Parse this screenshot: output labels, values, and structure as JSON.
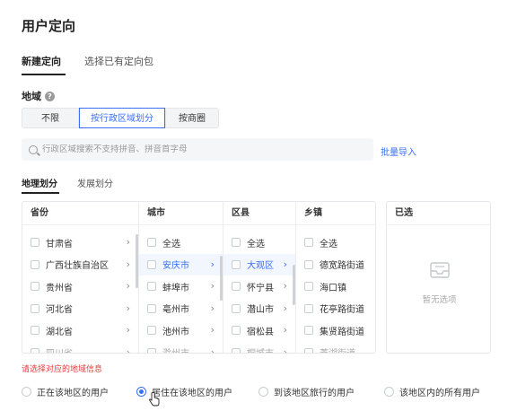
{
  "page_title": "用户定向",
  "mode_tabs": [
    {
      "label": "新建定向",
      "active": true
    },
    {
      "label": "选择已有定向包",
      "active": false
    }
  ],
  "region_section": {
    "label": "地域",
    "help_icon": "question-circle-icon"
  },
  "region_modes": [
    {
      "label": "不限",
      "active": false
    },
    {
      "label": "按行政区域划分",
      "active": true
    },
    {
      "label": "按商圈",
      "active": false
    }
  ],
  "search": {
    "placeholder": "行政区域搜索不支持拼音、拼音首字母",
    "value": "",
    "icon": "search-icon"
  },
  "bulk_import_label": "批量导入",
  "division_tabs": [
    {
      "label": "地理划分",
      "active": true
    },
    {
      "label": "发展划分",
      "active": false
    }
  ],
  "picker": {
    "columns": [
      {
        "header": "省份",
        "items": [
          {
            "label": "甘肃省",
            "has_children": true,
            "selected": false
          },
          {
            "label": "广西壮族自治区",
            "has_children": true,
            "selected": false
          },
          {
            "label": "贵州省",
            "has_children": true,
            "selected": false
          },
          {
            "label": "河北省",
            "has_children": true,
            "selected": false
          },
          {
            "label": "湖北省",
            "has_children": true,
            "selected": false
          },
          {
            "label": "四川省",
            "has_children": true,
            "selected": false,
            "partial": true
          }
        ]
      },
      {
        "header": "城市",
        "items": [
          {
            "label": "全选",
            "has_children": false,
            "selected": false
          },
          {
            "label": "安庆市",
            "has_children": true,
            "selected": true
          },
          {
            "label": "蚌埠市",
            "has_children": true,
            "selected": false
          },
          {
            "label": "亳州市",
            "has_children": true,
            "selected": false
          },
          {
            "label": "池州市",
            "has_children": true,
            "selected": false
          },
          {
            "label": "滁州市",
            "has_children": true,
            "selected": false,
            "partial": true
          }
        ]
      },
      {
        "header": "区县",
        "items": [
          {
            "label": "全选",
            "has_children": false,
            "selected": false
          },
          {
            "label": "大观区",
            "has_children": true,
            "selected": true
          },
          {
            "label": "怀宁县",
            "has_children": true,
            "selected": false
          },
          {
            "label": "潜山市",
            "has_children": true,
            "selected": false
          },
          {
            "label": "宿松县",
            "has_children": true,
            "selected": false
          },
          {
            "label": "桐城市",
            "has_children": true,
            "selected": false,
            "partial": true
          }
        ]
      },
      {
        "header": "乡镇",
        "items": [
          {
            "label": "全选",
            "has_children": false,
            "selected": false
          },
          {
            "label": "德宽路街道",
            "has_children": false,
            "selected": false
          },
          {
            "label": "海口镇",
            "has_children": false,
            "selected": false
          },
          {
            "label": "花亭路街道",
            "has_children": false,
            "selected": false
          },
          {
            "label": "集贤路街道",
            "has_children": false,
            "selected": false
          },
          {
            "label": "菱湖街道",
            "has_children": false,
            "selected": false,
            "partial": true
          }
        ]
      }
    ],
    "chosen": {
      "header": "已选",
      "empty_text": "暂无选项",
      "empty_icon": "empty-inbox-icon"
    }
  },
  "error_message": "请选择对应的地域信息",
  "user_scope_options": [
    {
      "label": "正在该地区的用户",
      "checked": false
    },
    {
      "label": "居住在该地区的用户",
      "checked": true
    },
    {
      "label": "到该地区旅行的用户",
      "checked": false
    },
    {
      "label": "该地区内的所有用户",
      "checked": false
    }
  ],
  "colors": {
    "accent": "#3b6ff5",
    "error": "#e23c3c",
    "text": "#333333",
    "muted": "#aaaaaa"
  }
}
